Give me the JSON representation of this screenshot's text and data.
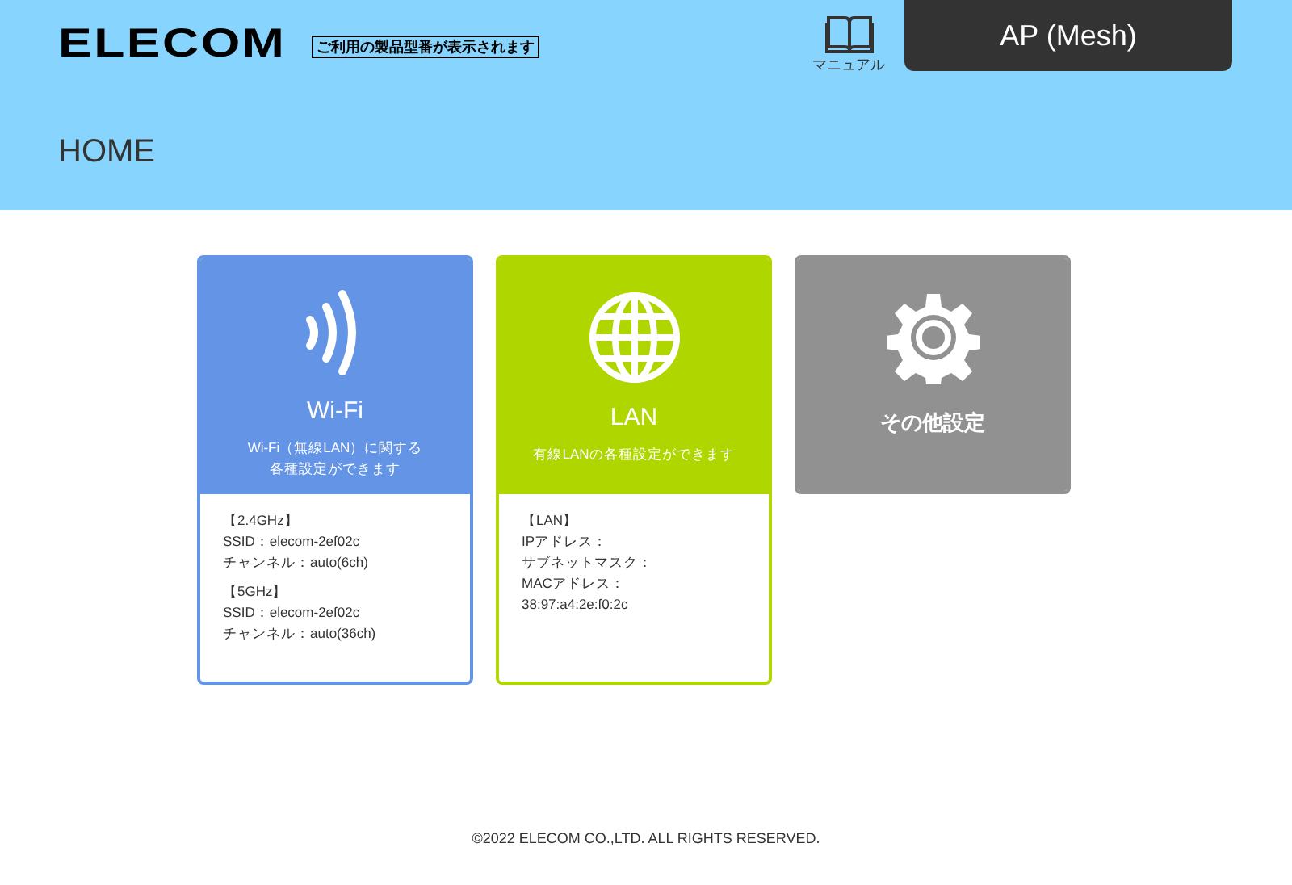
{
  "header": {
    "logo": "ELECOM",
    "model_placeholder": "ご利用の製品型番が表示されます",
    "manual_link": "マニュアル",
    "mode_tab": "AP (Mesh)"
  },
  "page_title": "HOME",
  "cards": [
    {
      "kind": "wifi",
      "title": "Wi-Fi",
      "description": [
        "Wi-Fi（無線LAN）に関する",
        "各種設定ができます"
      ],
      "color": "#6494e6",
      "sections": [
        {
          "heading": "【2.4GHz】",
          "lines": [
            "SSID：elecom-2ef02c",
            "チャンネル：auto(6ch)"
          ]
        },
        {
          "heading": "【5GHz】",
          "lines": [
            "SSID：elecom-2ef02c",
            "チャンネル：auto(36ch)"
          ]
        }
      ]
    },
    {
      "kind": "lan",
      "title": "LAN",
      "description": [
        "有線LANの各種設定ができます"
      ],
      "color": "#b0d600",
      "sections": [
        {
          "heading": "【LAN】",
          "lines": [
            "IPアドレス：",
            "サブネットマスク：",
            "MACアドレス：",
            "38:97:a4:2e:f0:2c"
          ]
        }
      ]
    },
    {
      "kind": "settings",
      "title": "その他設定",
      "color": "#919191"
    }
  ],
  "footer": "©2022 ELECOM CO.,LTD. ALL RIGHTS RESERVED."
}
